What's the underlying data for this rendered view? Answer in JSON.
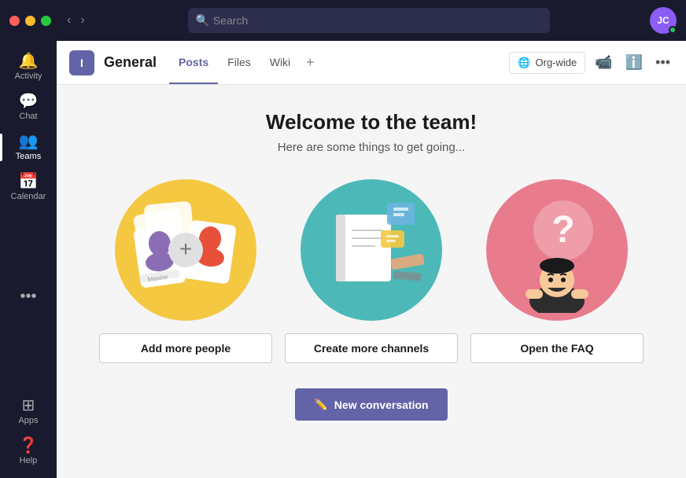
{
  "titlebar": {
    "search_placeholder": "Search"
  },
  "avatar": {
    "initials": "JC",
    "status": "online"
  },
  "sidebar": {
    "items": [
      {
        "id": "activity",
        "label": "Activity",
        "icon": "🔔",
        "active": false
      },
      {
        "id": "chat",
        "label": "Chat",
        "icon": "💬",
        "active": false
      },
      {
        "id": "teams",
        "label": "Teams",
        "icon": "👥",
        "active": true
      },
      {
        "id": "calendar",
        "label": "Calendar",
        "icon": "📅",
        "active": false
      }
    ],
    "more_label": "...",
    "apps_label": "Apps",
    "help_label": "Help"
  },
  "channel": {
    "icon_letter": "I",
    "name": "General",
    "tabs": [
      {
        "id": "posts",
        "label": "Posts",
        "active": true
      },
      {
        "id": "files",
        "label": "Files",
        "active": false
      },
      {
        "id": "wiki",
        "label": "Wiki",
        "active": false
      }
    ],
    "add_tab_label": "+",
    "org_wide_label": "Org-wide"
  },
  "welcome": {
    "title": "Welcome to the team!",
    "subtitle": "Here are some things to get going...",
    "cards": [
      {
        "id": "add-people",
        "button_label": "Add more people",
        "color": "yellow"
      },
      {
        "id": "create-channels",
        "button_label": "Create more channels",
        "color": "teal"
      },
      {
        "id": "open-faq",
        "button_label": "Open the FAQ",
        "color": "pink"
      }
    ],
    "new_conversation_label": "New conversation"
  }
}
